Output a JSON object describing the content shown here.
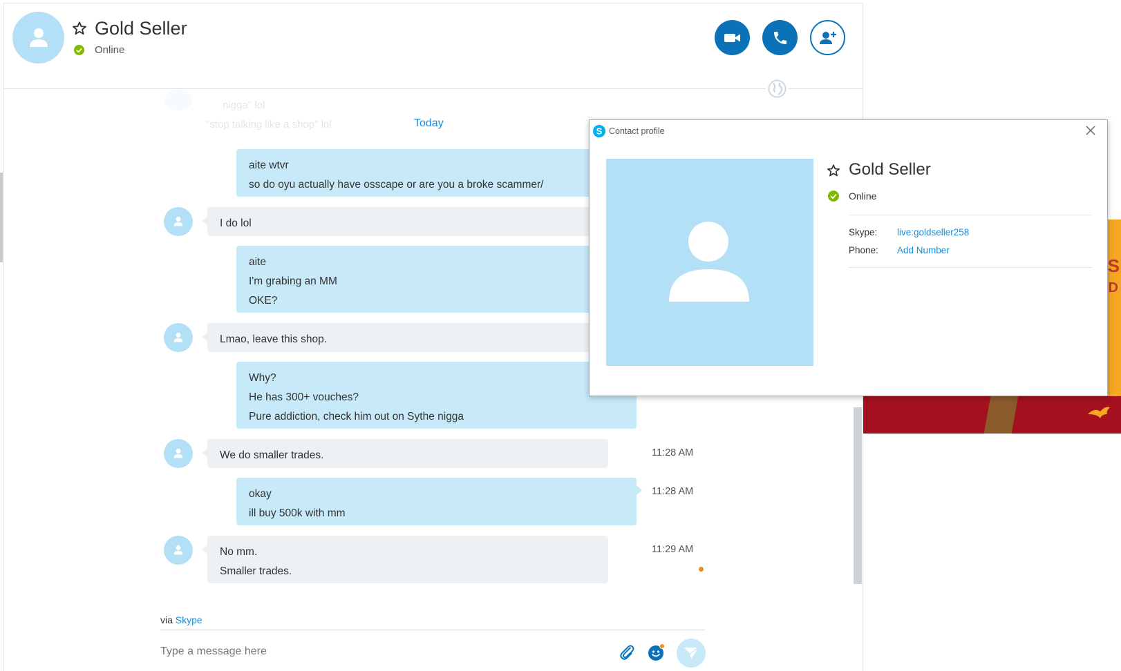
{
  "header": {
    "contact_name": "Gold Seller",
    "status": "Online"
  },
  "chat": {
    "date_divider": "Today",
    "faded_lines": [
      "nigga\" lol",
      "\"stop talking like a shop\" lol"
    ],
    "messages": [
      {
        "direction": "out",
        "lines": [
          "aite wtvr",
          "so do oyu actually have osscape or are you a broke scammer/"
        ],
        "time": ""
      },
      {
        "direction": "in",
        "lines": [
          "I do lol"
        ],
        "time": ""
      },
      {
        "direction": "out",
        "lines": [
          "aite",
          "I'm grabing an MM",
          "OKE?"
        ],
        "time": ""
      },
      {
        "direction": "in",
        "lines": [
          "Lmao, leave this shop."
        ],
        "time": ""
      },
      {
        "direction": "out",
        "lines": [
          "Why?",
          "He has 300+ vouches?",
          "Pure addiction, check him out on Sythe nigga"
        ],
        "time": ""
      },
      {
        "direction": "in",
        "lines": [
          "We do smaller trades."
        ],
        "time": "11:28 AM"
      },
      {
        "direction": "out",
        "lines": [
          "okay",
          "ill buy 500k with mm"
        ],
        "time": "11:28 AM"
      },
      {
        "direction": "in",
        "lines": [
          "No mm.",
          "Smaller trades."
        ],
        "time": "11:29 AM"
      }
    ]
  },
  "composer": {
    "via_prefix": "via",
    "via_link": "Skype",
    "placeholder": "Type a message here"
  },
  "profile_dialog": {
    "title": "Contact profile",
    "name": "Gold Seller",
    "status": "Online",
    "skype_label": "Skype:",
    "skype_value": "live:goldseller258",
    "phone_label": "Phone:",
    "phone_value": "Add Number"
  },
  "ad": {
    "text_s": "S",
    "text_d": "D"
  },
  "colors": {
    "accent": "#0c72b8",
    "link": "#1d8bd6",
    "outgoing_bubble": "#c7e9f8",
    "incoming_bubble": "#eef1f4",
    "avatar": "#b3e0f6",
    "presence_online": "#7fba00",
    "unread": "#f28a1e"
  }
}
